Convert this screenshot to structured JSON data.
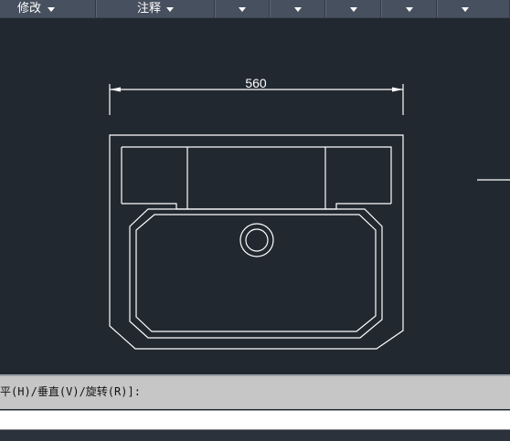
{
  "ribbon": {
    "tabs": [
      {
        "label": "修改"
      },
      {
        "label": "注释"
      },
      {
        "label": ""
      },
      {
        "label": ""
      },
      {
        "label": ""
      },
      {
        "label": ""
      },
      {
        "label": ""
      }
    ]
  },
  "drawing": {
    "dimension_text": "560"
  },
  "command": {
    "history_text": "平(H)/垂直(V)/旋转(R)]:",
    "input_value": ""
  },
  "colors": {
    "background": "#212830",
    "ribbon": "#47505e",
    "lines": "#ffffff"
  }
}
